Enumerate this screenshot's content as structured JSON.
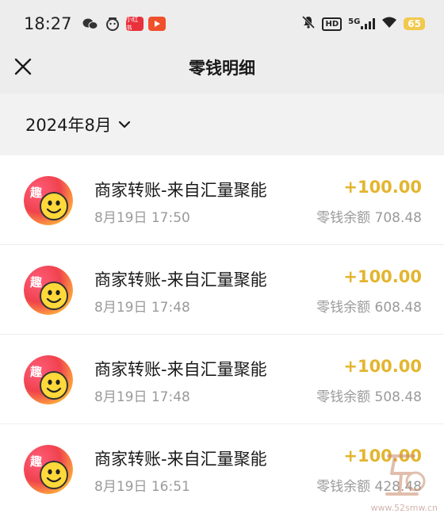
{
  "status_bar": {
    "time": "18:27",
    "app_icons": [
      "wechat-icon",
      "face-icon",
      "red-app-icon",
      "video-app-icon"
    ],
    "red_app_text": "小红书",
    "hd": "HD",
    "network": "5G",
    "battery": "65",
    "colors": {
      "battery": "#f2c94c"
    }
  },
  "header": {
    "title": "零钱明细",
    "close_icon": "close-icon"
  },
  "filter": {
    "month": "2024年8月",
    "chevron_icon": "chevron-down-icon"
  },
  "transactions": [
    {
      "title": "商家转账-来自汇量聚能",
      "time": "8月19日 17:50",
      "amount": "+100.00",
      "balance": "零钱余额 708.48"
    },
    {
      "title": "商家转账-来自汇量聚能",
      "time": "8月19日 17:48",
      "amount": "+100.00",
      "balance": "零钱余额 608.48"
    },
    {
      "title": "商家转账-来自汇量聚能",
      "time": "8月19日 17:48",
      "amount": "+100.00",
      "balance": "零钱余额 508.48"
    },
    {
      "title": "商家转账-来自汇量聚能",
      "time": "8月19日 16:51",
      "amount": "+100.00",
      "balance": "零钱余额 428.48"
    }
  ],
  "watermark": "www.52smw.cn",
  "colors": {
    "amount": "#e3b52f",
    "secondary_text": "#9a9a9a",
    "background": "#ededed"
  }
}
